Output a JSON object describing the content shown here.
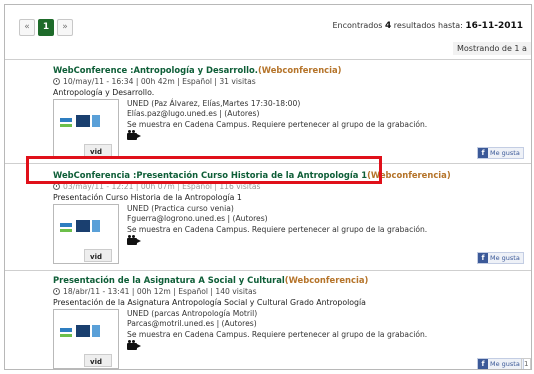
{
  "pager": {
    "prev": "«",
    "current": "1",
    "next": "»"
  },
  "results_info": {
    "found_prefix": "Encontrados",
    "found_count": "4",
    "found_mid": "resultados hasta:",
    "date": "16-11-2011",
    "showing": "Mostrando de 1 a"
  },
  "items": [
    {
      "title": "WebConference :Antropología y Desarrollo.",
      "type": "(Webconferencia)",
      "meta": "10/may/11 - 16:34 | 00h 42m | Español | 31 visitas",
      "desc": "Antropología y Desarrollo.",
      "line1": "UNED (Paz Álvarez, Elías,Martes 17:30-18:00)",
      "line2": "Elías.paz@lugo.uned.es | (Autores)",
      "line3": "Se muestra en Cadena Campus. Requiere pertenecer al grupo de la grabación.",
      "thumb_caption": "vid",
      "like": "Me gusta"
    },
    {
      "title": "WebConferencia :Presentación Curso Historia de la Antropología 1",
      "type": "(Webconferencia)",
      "meta": "03/may/11 - 12:21 | 00h 07m | Español | 116 visitas",
      "desc": "Presentación Curso Historia de la Antropología 1",
      "line1": "UNED (Practica curso venia)",
      "line2": "Fguerra@logrono.uned.es | (Autores)",
      "line3": "Se muestra en Cadena Campus. Requiere pertenecer al grupo de la grabación.",
      "thumb_caption": "vid",
      "like": "Me gusta"
    },
    {
      "title": "Presentación de la Asignatura A Social y Cultural",
      "type": "(Webconferencia)",
      "meta": "18/abr/11 - 13:41 | 00h 12m | Español | 140 visitas",
      "desc": "Presentación de la Asignatura Antropología Social y Cultural Grado Antropología",
      "line1": "UNED (parcas Antropología Motril)",
      "line2": "Parcas@motril.uned.es | (Autores)",
      "line3": "Se muestra en Cadena Campus. Requiere pertenecer al grupo de la grabación.",
      "thumb_caption": "vid",
      "like": "Me gusta",
      "like_count": "1"
    }
  ],
  "icons": {
    "fb_glyph": "f"
  }
}
